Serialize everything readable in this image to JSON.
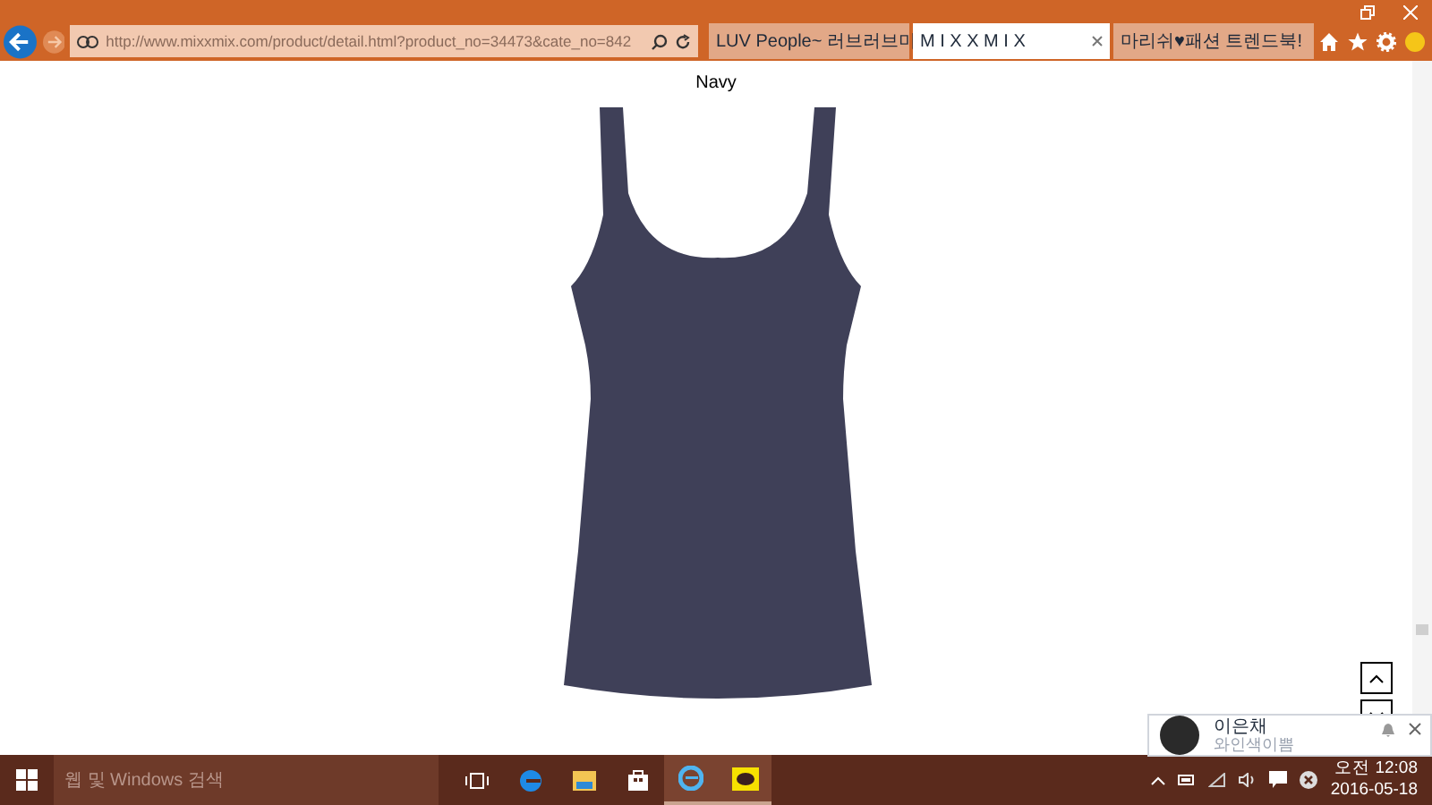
{
  "browser": {
    "url": "http://www.mixxmix.com/product/detail.html?product_no=34473&cate_no=842",
    "tabs": [
      {
        "label": "LUV People~ 러브러브미",
        "selected": false
      },
      {
        "label": "M I X X M I X",
        "selected": true
      },
      {
        "label": "마리쉬♥패션 트렌드북!",
        "selected": false
      }
    ]
  },
  "page": {
    "color_label": "Navy"
  },
  "notification": {
    "name": "이은채",
    "message": "와인색이쁨"
  },
  "taskbar": {
    "search_placeholder": "웹 및 Windows 검색",
    "time": "오전 12:08",
    "date": "2016-05-18"
  }
}
